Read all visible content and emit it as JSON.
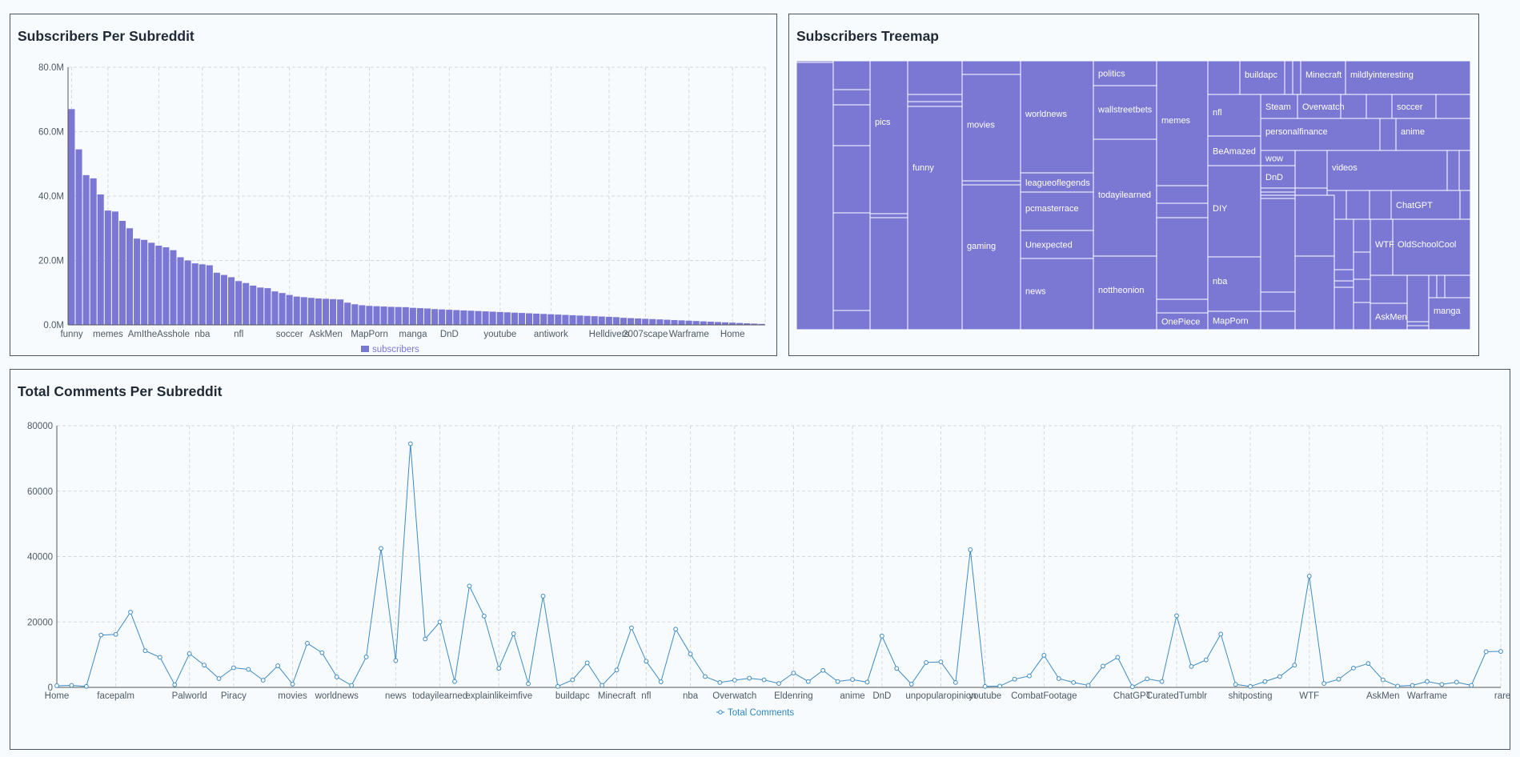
{
  "colors": {
    "bar": "#7b78d4",
    "line": "#3d8bc2",
    "grid": "#d3d9de",
    "axis_text": "#4c5a66",
    "legend_bar": "#7b78d4",
    "legend_line": "#2d86c2"
  },
  "chart_data": [
    {
      "type": "bar",
      "title": "Subscribers Per Subreddit",
      "y_ticks": [
        "0.0M",
        "20.0M",
        "40.0M",
        "60.0M",
        "80.0M"
      ],
      "ylim": [
        0,
        80000000
      ],
      "x_tick_labels": [
        "funny",
        "memes",
        "AmItheAsshole",
        "nba",
        "nfl",
        "soccer",
        "AskMen",
        "MapPorn",
        "manga",
        "DnD",
        "youtube",
        "antiwork",
        "Helldivers",
        "2007scape",
        "Warframe",
        "Home"
      ],
      "x_tick_indices": [
        0,
        5,
        12,
        18,
        23,
        30,
        35,
        41,
        47,
        52,
        59,
        66,
        74,
        79,
        85,
        91
      ],
      "series": [
        {
          "name": "subscribers",
          "values": [
            67000000,
            54500000,
            46500000,
            45500000,
            40500000,
            35500000,
            35200000,
            32300000,
            30000000,
            26800000,
            26400000,
            25500000,
            24600000,
            24100000,
            23200000,
            21000000,
            20000000,
            19100000,
            18800000,
            18500000,
            16200000,
            15500000,
            14800000,
            13600000,
            13000000,
            12200000,
            11600000,
            11400000,
            10400000,
            9900000,
            9300000,
            8800000,
            8600000,
            8400000,
            8200000,
            8100000,
            8000000,
            7900000,
            6900000,
            6400000,
            6100000,
            5900000,
            5800000,
            5700000,
            5600000,
            5550000,
            5500000,
            5300000,
            5200000,
            5100000,
            4900000,
            4800000,
            4700000,
            4600000,
            4500000,
            4400000,
            4300000,
            4200000,
            4100000,
            4000000,
            3900000,
            3800000,
            3700000,
            3600000,
            3500000,
            3400000,
            3300000,
            3200000,
            3100000,
            3000000,
            2900000,
            2800000,
            2700000,
            2600000,
            2500000,
            2400000,
            2200000,
            2100000,
            2000000,
            1900000,
            1800000,
            1700000,
            1600000,
            1500000,
            1400000,
            1300000,
            1200000,
            1100000,
            1000000,
            900000,
            800000,
            700000,
            600000,
            500000,
            400000,
            300000
          ]
        }
      ],
      "legend": "bottom"
    },
    {
      "type": "treemap",
      "title": "Subscribers Treemap",
      "labels": [
        "pics",
        "funny",
        "movies",
        "gaming",
        "worldnews",
        "leagueoflegends",
        "pcmasterrace",
        "Unexpected",
        "news",
        "politics",
        "wallstreetbets",
        "todayilearned",
        "nottheonion",
        "memes",
        "OnePiece",
        "nfl",
        "BeAmazed",
        "DIY",
        "nba",
        "MapPorn",
        "buildapc",
        "Minecraft",
        "mildlyinteresting",
        "Steam",
        "Overwatch",
        "soccer",
        "personalfinance",
        "anime",
        "wow",
        "DnD",
        "videos",
        "ChatGPT",
        "WTF",
        "OldSchoolCool",
        "AskMen",
        "manga"
      ]
    },
    {
      "type": "line",
      "title": "Total Comments Per Subreddit",
      "y_ticks": [
        "0",
        "20000",
        "40000",
        "60000",
        "80000"
      ],
      "ylim": [
        0,
        80000
      ],
      "x_tick_labels": [
        "Home",
        "facepalm",
        "Palworld",
        "Piracy",
        "movies",
        "worldnews",
        "news",
        "todayilearned",
        "explainlikeimfive",
        "buildapc",
        "Minecraft",
        "nfl",
        "nba",
        "Overwatch",
        "Eldenring",
        "anime",
        "DnD",
        "unpopularopinion",
        "youtube",
        "CombatFootage",
        "ChatGPT",
        "CuratedTumblr",
        "shitposting",
        "WTF",
        "AskMen",
        "Warframe",
        "rareinsults"
      ],
      "x_tick_indices": [
        0,
        4,
        9,
        12,
        16,
        19,
        23,
        26,
        30,
        35,
        38,
        40,
        43,
        46,
        50,
        54,
        56,
        60,
        63,
        67,
        73,
        76,
        81,
        85,
        90,
        93,
        99
      ],
      "series": [
        {
          "name": "Total Comments",
          "values": [
            500,
            600,
            300,
            16000,
            16200,
            23000,
            11200,
            9200,
            800,
            10300,
            6800,
            2700,
            6000,
            5500,
            2200,
            6600,
            1000,
            13500,
            10600,
            3200,
            600,
            9300,
            42500,
            8200,
            74500,
            14800,
            20000,
            1800,
            31000,
            21800,
            5800,
            16400,
            1100,
            27900,
            300,
            2300,
            7500,
            600,
            5300,
            18200,
            8000,
            1700,
            17800,
            10200,
            3300,
            1500,
            2200,
            2800,
            2300,
            1200,
            4400,
            1800,
            5200,
            1800,
            2400,
            1600,
            15700,
            5800,
            1000,
            7600,
            7800,
            1500,
            42100,
            300,
            400,
            2500,
            3500,
            9800,
            2700,
            1500,
            600,
            6500,
            9200,
            200,
            2600,
            1800,
            21900,
            6400,
            8400,
            16300,
            900,
            300,
            1800,
            3300,
            6800,
            34000,
            1200,
            2500,
            5900,
            7300,
            2300,
            400,
            600,
            1800,
            900,
            1600,
            600,
            10900,
            11000
          ]
        }
      ],
      "legend": "bottom"
    }
  ]
}
